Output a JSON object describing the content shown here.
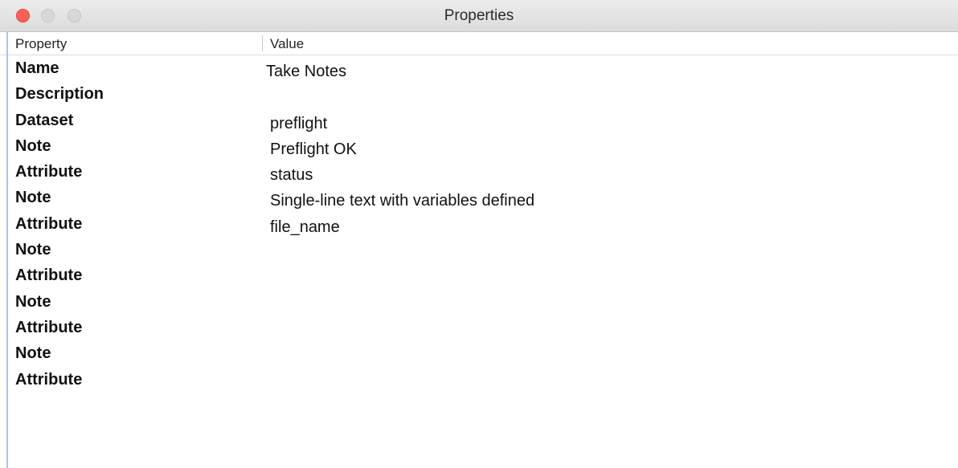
{
  "window": {
    "title": "Properties"
  },
  "table": {
    "columns": {
      "property": "Property",
      "value": "Value"
    },
    "rows": [
      {
        "property": "Name",
        "value": "Take Notes"
      },
      {
        "property": "Description",
        "value": ""
      },
      {
        "property": "Dataset",
        "value": "preflight"
      },
      {
        "property": "Note",
        "value": "Preflight OK"
      },
      {
        "property": "Attribute",
        "value": "status"
      },
      {
        "property": "Note",
        "value": "Single-line text with variables defined"
      },
      {
        "property": "Attribute",
        "value": "file_name"
      },
      {
        "property": "Note",
        "value": ""
      },
      {
        "property": "Attribute",
        "value": ""
      },
      {
        "property": "Note",
        "value": ""
      },
      {
        "property": "Attribute",
        "value": ""
      },
      {
        "property": "Note",
        "value": ""
      },
      {
        "property": "Attribute",
        "value": ""
      }
    ]
  },
  "colors": {
    "close_button": "#fc5f57",
    "inactive_button": "#d8d8d8",
    "selection_edge": "#a9c6ea"
  }
}
